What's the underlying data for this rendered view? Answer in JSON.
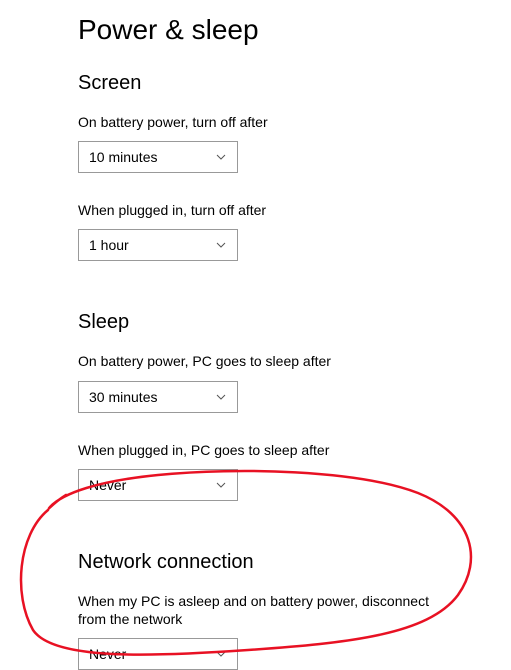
{
  "page": {
    "title": "Power & sleep"
  },
  "sections": {
    "screen": {
      "title": "Screen",
      "battery": {
        "label": "On battery power, turn off after",
        "value": "10 minutes"
      },
      "plugged": {
        "label": "When plugged in, turn off after",
        "value": "1 hour"
      }
    },
    "sleep": {
      "title": "Sleep",
      "battery": {
        "label": "On battery power, PC goes to sleep after",
        "value": "30 minutes"
      },
      "plugged": {
        "label": "When plugged in, PC goes to sleep after",
        "value": "Never"
      }
    },
    "network": {
      "title": "Network connection",
      "disconnect": {
        "label": "When my PC is asleep and on battery power, disconnect from the network",
        "value": "Never"
      }
    }
  },
  "annotation": {
    "color": "#e81123",
    "description": "red-circle-highlight"
  }
}
